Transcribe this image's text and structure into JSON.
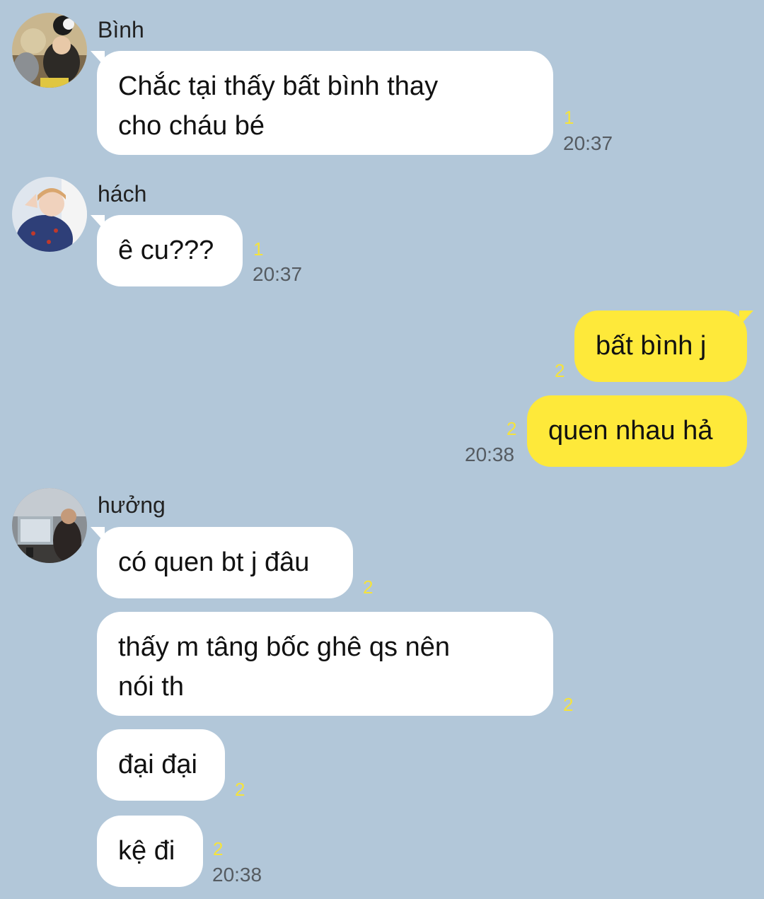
{
  "colors": {
    "background": "#b2c7d9",
    "incoming_bubble": "#ffffff",
    "outgoing_bubble": "#fee93a",
    "unread_count": "#f5e33c",
    "timestamp": "#555b61"
  },
  "messages": [
    {
      "sender": "Bình",
      "avatar_icon": "user-photo-icon",
      "bubbles": [
        {
          "lines": [
            "Chắc tại thấy bất bình thay",
            "cho cháu bé"
          ],
          "unread": "1",
          "time": "20:37"
        }
      ]
    },
    {
      "sender": "hách",
      "avatar_icon": "user-photo-icon",
      "bubbles": [
        {
          "lines": [
            "ê cu???"
          ],
          "unread": "1",
          "time": "20:37"
        }
      ]
    },
    {
      "sender": "me",
      "bubbles": [
        {
          "lines": [
            "bất bình j"
          ],
          "unread": "2",
          "time": ""
        },
        {
          "lines": [
            "quen nhau hả"
          ],
          "unread": "2",
          "time": "20:38"
        }
      ]
    },
    {
      "sender": "hưởng",
      "avatar_icon": "user-photo-icon",
      "bubbles": [
        {
          "lines": [
            "có quen bt j đâu"
          ],
          "unread": "2",
          "time": ""
        },
        {
          "lines": [
            "thấy m tâng bốc ghê qs nên",
            "nói th"
          ],
          "unread": "2",
          "time": ""
        },
        {
          "lines": [
            "đại đại"
          ],
          "unread": "2",
          "time": ""
        },
        {
          "lines": [
            "kệ đi"
          ],
          "unread": "2",
          "time": "20:38"
        }
      ]
    }
  ]
}
